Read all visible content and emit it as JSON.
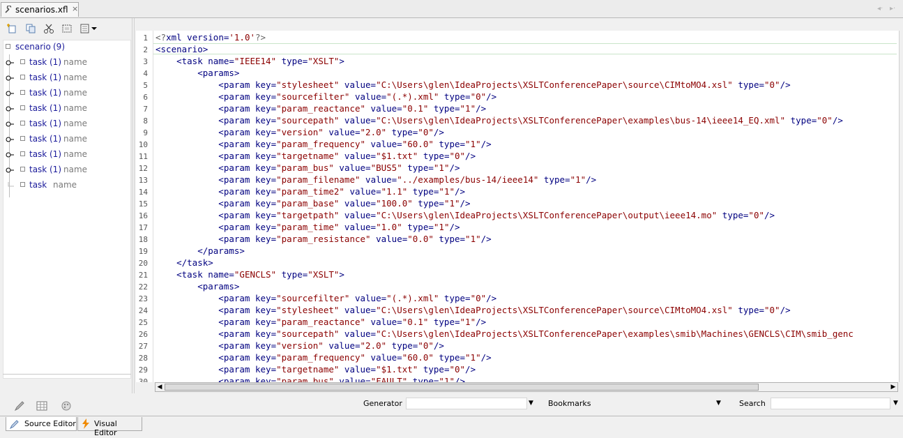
{
  "tabs": [
    {
      "title": "scenarios.xfl",
      "close": "×"
    }
  ],
  "tab_nav": {
    "back": "◂·",
    "forward": "▸·"
  },
  "tree": {
    "root": {
      "label": "scenario",
      "count": "(9)"
    },
    "items": [
      {
        "label": "task",
        "count": "(1)",
        "name": "name"
      },
      {
        "label": "task",
        "count": "(1)",
        "name": "name"
      },
      {
        "label": "task",
        "count": "(1)",
        "name": "name"
      },
      {
        "label": "task",
        "count": "(1)",
        "name": "name"
      },
      {
        "label": "task",
        "count": "(1)",
        "name": "name"
      },
      {
        "label": "task",
        "count": "(1)",
        "name": "name"
      },
      {
        "label": "task",
        "count": "(1)",
        "name": "name"
      },
      {
        "label": "task",
        "count": "(1)",
        "name": "name"
      },
      {
        "label": "task",
        "count": "",
        "name": "name"
      }
    ]
  },
  "editor": {
    "line_numbers": [
      "1",
      "2",
      "3",
      "4",
      "5",
      "6",
      "7",
      "8",
      "9",
      "10",
      "11",
      "12",
      "13",
      "14",
      "15",
      "16",
      "17",
      "18",
      "19",
      "20",
      "21",
      "22",
      "23",
      "24",
      "25",
      "26",
      "27",
      "28",
      "29",
      "30"
    ],
    "lines": [
      [
        [
          "g",
          "<?"
        ],
        [
          "b",
          "xml version="
        ],
        [
          "r",
          "'1.0'"
        ],
        [
          "g",
          "?>"
        ]
      ],
      [
        [
          "b",
          "<scenario>"
        ]
      ],
      [
        [
          "b",
          "    <task name="
        ],
        [
          "r",
          "\"IEEE14\""
        ],
        [
          "b",
          " type="
        ],
        [
          "r",
          "\"XSLT\""
        ],
        [
          "b",
          ">"
        ]
      ],
      [
        [
          "b",
          "        <params>"
        ]
      ],
      [
        [
          "b",
          "            <param key="
        ],
        [
          "r",
          "\"stylesheet\""
        ],
        [
          "b",
          " value="
        ],
        [
          "r",
          "\"C:\\Users\\glen\\IdeaProjects\\XSLTConferencePaper\\source\\CIMtoMO4.xsl\""
        ],
        [
          "b",
          " type="
        ],
        [
          "r",
          "\"0\""
        ],
        [
          "b",
          "/>"
        ]
      ],
      [
        [
          "b",
          "            <param key="
        ],
        [
          "r",
          "\"sourcefilter\""
        ],
        [
          "b",
          " value="
        ],
        [
          "r",
          "\"(.*).xml\""
        ],
        [
          "b",
          " type="
        ],
        [
          "r",
          "\"0\""
        ],
        [
          "b",
          "/>"
        ]
      ],
      [
        [
          "b",
          "            <param key="
        ],
        [
          "r",
          "\"param_reactance\""
        ],
        [
          "b",
          " value="
        ],
        [
          "r",
          "\"0.1\""
        ],
        [
          "b",
          " type="
        ],
        [
          "r",
          "\"1\""
        ],
        [
          "b",
          "/>"
        ]
      ],
      [
        [
          "b",
          "            <param key="
        ],
        [
          "r",
          "\"sourcepath\""
        ],
        [
          "b",
          " value="
        ],
        [
          "r",
          "\"C:\\Users\\glen\\IdeaProjects\\XSLTConferencePaper\\examples\\bus-14\\ieee14_EQ.xml\""
        ],
        [
          "b",
          " type="
        ],
        [
          "r",
          "\"0\""
        ],
        [
          "b",
          "/>"
        ]
      ],
      [
        [
          "b",
          "            <param key="
        ],
        [
          "r",
          "\"version\""
        ],
        [
          "b",
          " value="
        ],
        [
          "r",
          "\"2.0\""
        ],
        [
          "b",
          " type="
        ],
        [
          "r",
          "\"0\""
        ],
        [
          "b",
          "/>"
        ]
      ],
      [
        [
          "b",
          "            <param key="
        ],
        [
          "r",
          "\"param_frequency\""
        ],
        [
          "b",
          " value="
        ],
        [
          "r",
          "\"60.0\""
        ],
        [
          "b",
          " type="
        ],
        [
          "r",
          "\"1\""
        ],
        [
          "b",
          "/>"
        ]
      ],
      [
        [
          "b",
          "            <param key="
        ],
        [
          "r",
          "\"targetname\""
        ],
        [
          "b",
          " value="
        ],
        [
          "r",
          "\"$1.txt\""
        ],
        [
          "b",
          " type="
        ],
        [
          "r",
          "\"0\""
        ],
        [
          "b",
          "/>"
        ]
      ],
      [
        [
          "b",
          "            <param key="
        ],
        [
          "r",
          "\"param_bus\""
        ],
        [
          "b",
          " value="
        ],
        [
          "r",
          "\"BUS5\""
        ],
        [
          "b",
          " type="
        ],
        [
          "r",
          "\"1\""
        ],
        [
          "b",
          "/>"
        ]
      ],
      [
        [
          "b",
          "            <param key="
        ],
        [
          "r",
          "\"param_filename\""
        ],
        [
          "b",
          " value="
        ],
        [
          "r",
          "\"../examples/bus-14/ieee14\""
        ],
        [
          "b",
          " type="
        ],
        [
          "r",
          "\"1\""
        ],
        [
          "b",
          "/>"
        ]
      ],
      [
        [
          "b",
          "            <param key="
        ],
        [
          "r",
          "\"param_time2\""
        ],
        [
          "b",
          " value="
        ],
        [
          "r",
          "\"1.1\""
        ],
        [
          "b",
          " type="
        ],
        [
          "r",
          "\"1\""
        ],
        [
          "b",
          "/>"
        ]
      ],
      [
        [
          "b",
          "            <param key="
        ],
        [
          "r",
          "\"param_base\""
        ],
        [
          "b",
          " value="
        ],
        [
          "r",
          "\"100.0\""
        ],
        [
          "b",
          " type="
        ],
        [
          "r",
          "\"1\""
        ],
        [
          "b",
          "/>"
        ]
      ],
      [
        [
          "b",
          "            <param key="
        ],
        [
          "r",
          "\"targetpath\""
        ],
        [
          "b",
          " value="
        ],
        [
          "r",
          "\"C:\\Users\\glen\\IdeaProjects\\XSLTConferencePaper\\output\\ieee14.mo\""
        ],
        [
          "b",
          " type="
        ],
        [
          "r",
          "\"0\""
        ],
        [
          "b",
          "/>"
        ]
      ],
      [
        [
          "b",
          "            <param key="
        ],
        [
          "r",
          "\"param_time\""
        ],
        [
          "b",
          " value="
        ],
        [
          "r",
          "\"1.0\""
        ],
        [
          "b",
          " type="
        ],
        [
          "r",
          "\"1\""
        ],
        [
          "b",
          "/>"
        ]
      ],
      [
        [
          "b",
          "            <param key="
        ],
        [
          "r",
          "\"param_resistance\""
        ],
        [
          "b",
          " value="
        ],
        [
          "r",
          "\"0.0\""
        ],
        [
          "b",
          " type="
        ],
        [
          "r",
          "\"1\""
        ],
        [
          "b",
          "/>"
        ]
      ],
      [
        [
          "b",
          "        </params>"
        ]
      ],
      [
        [
          "b",
          "    </task>"
        ]
      ],
      [
        [
          "b",
          "    <task name="
        ],
        [
          "r",
          "\"GENCLS\""
        ],
        [
          "b",
          " type="
        ],
        [
          "r",
          "\"XSLT\""
        ],
        [
          "b",
          ">"
        ]
      ],
      [
        [
          "b",
          "        <params>"
        ]
      ],
      [
        [
          "b",
          "            <param key="
        ],
        [
          "r",
          "\"sourcefilter\""
        ],
        [
          "b",
          " value="
        ],
        [
          "r",
          "\"(.*).xml\""
        ],
        [
          "b",
          " type="
        ],
        [
          "r",
          "\"0\""
        ],
        [
          "b",
          "/>"
        ]
      ],
      [
        [
          "b",
          "            <param key="
        ],
        [
          "r",
          "\"stylesheet\""
        ],
        [
          "b",
          " value="
        ],
        [
          "r",
          "\"C:\\Users\\glen\\IdeaProjects\\XSLTConferencePaper\\source\\CIMtoMO4.xsl\""
        ],
        [
          "b",
          " type="
        ],
        [
          "r",
          "\"0\""
        ],
        [
          "b",
          "/>"
        ]
      ],
      [
        [
          "b",
          "            <param key="
        ],
        [
          "r",
          "\"param_reactance\""
        ],
        [
          "b",
          " value="
        ],
        [
          "r",
          "\"0.1\""
        ],
        [
          "b",
          " type="
        ],
        [
          "r",
          "\"1\""
        ],
        [
          "b",
          "/>"
        ]
      ],
      [
        [
          "b",
          "            <param key="
        ],
        [
          "r",
          "\"sourcepath\""
        ],
        [
          "b",
          " value="
        ],
        [
          "r",
          "\"C:\\Users\\glen\\IdeaProjects\\XSLTConferencePaper\\examples\\smib\\Machines\\GENCLS\\CIM\\smib_genc"
        ]
      ],
      [
        [
          "b",
          "            <param key="
        ],
        [
          "r",
          "\"version\""
        ],
        [
          "b",
          " value="
        ],
        [
          "r",
          "\"2.0\""
        ],
        [
          "b",
          " type="
        ],
        [
          "r",
          "\"0\""
        ],
        [
          "b",
          "/>"
        ]
      ],
      [
        [
          "b",
          "            <param key="
        ],
        [
          "r",
          "\"param_frequency\""
        ],
        [
          "b",
          " value="
        ],
        [
          "r",
          "\"60.0\""
        ],
        [
          "b",
          " type="
        ],
        [
          "r",
          "\"1\""
        ],
        [
          "b",
          "/>"
        ]
      ],
      [
        [
          "b",
          "            <param key="
        ],
        [
          "r",
          "\"targetname\""
        ],
        [
          "b",
          " value="
        ],
        [
          "r",
          "\"$1.txt\""
        ],
        [
          "b",
          " type="
        ],
        [
          "r",
          "\"0\""
        ],
        [
          "b",
          "/>"
        ]
      ],
      [
        [
          "b",
          "            <param key="
        ],
        [
          "r",
          "\"param_bus\""
        ],
        [
          "b",
          " value="
        ],
        [
          "r",
          "\"FAULT\""
        ],
        [
          "b",
          " type="
        ],
        [
          "r",
          "\"1\""
        ],
        [
          "b",
          "/>"
        ]
      ]
    ]
  },
  "bottombar": {
    "generator_label": "Generator",
    "generator_value": "",
    "bookmarks_label": "Bookmarks",
    "search_label": "Search",
    "search_value": ""
  },
  "mode_tabs": {
    "source": "Source Editor",
    "visual": "Visual Editor"
  },
  "colors": {
    "tag": "#000080",
    "string": "#8b0000",
    "tree_label": "#1a1a9a"
  },
  "icons": {
    "toolbar": [
      "new-node-icon",
      "copy-icon",
      "cut-icon",
      "select-icon",
      "view-menu-icon"
    ],
    "bottom_tools": [
      "pencil-icon",
      "table-icon",
      "palette-icon"
    ]
  }
}
